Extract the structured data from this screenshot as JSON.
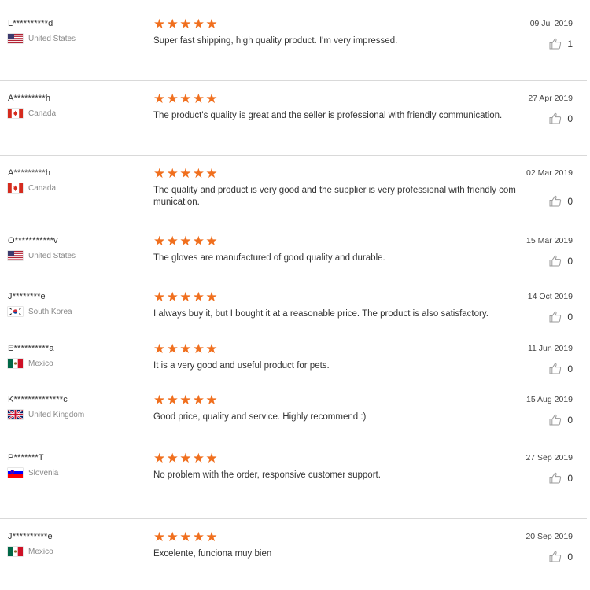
{
  "reviews": [
    {
      "name": "L**********d",
      "country": "United States",
      "flag": "us",
      "date": "09 Jul 2019",
      "comment": "Super fast shipping, high quality product. I'm very impressed.",
      "likes": "1"
    },
    {
      "name": "A*********h",
      "country": "Canada",
      "flag": "ca",
      "date": "27 Apr 2019",
      "comment": "The product's quality is great and the seller is professional with friendly communication.",
      "likes": "0"
    },
    {
      "name": "A*********h",
      "country": "Canada",
      "flag": "ca",
      "date": "02 Mar 2019",
      "comment": "The quality and product is very good and the supplier is very professional with friendly com munication.",
      "likes": "0"
    },
    {
      "name": "O***********v",
      "country": "United States",
      "flag": "us",
      "date": "15 Mar 2019",
      "comment": "The gloves are manufactured of good quality and durable.",
      "likes": "0"
    },
    {
      "name": "J********e",
      "country": "South Korea",
      "flag": "kr",
      "date": "14 Oct 2019",
      "comment": "I always buy it, but I bought it at a reasonable price. The product is also satisfactory.",
      "likes": "0"
    },
    {
      "name": "E**********a",
      "country": "Mexico",
      "flag": "mx",
      "date": "11 Jun 2019",
      "comment": "It is a very good and useful product for pets.",
      "likes": "0"
    },
    {
      "name": "K**************c",
      "country": "United Kingdom",
      "flag": "gb",
      "date": "15 Aug 2019",
      "comment": "Good price, quality and service. Highly recommend :)",
      "likes": "0"
    },
    {
      "name": "P*******T",
      "country": "Slovenia",
      "flag": "si",
      "date": "27 Sep 2019",
      "comment": "No problem with the order, responsive customer support.",
      "likes": "0"
    },
    {
      "name": "J**********e",
      "country": "Mexico",
      "flag": "mx",
      "date": "20 Sep 2019",
      "comment": "Excelente, funciona muy bien",
      "likes": "0"
    }
  ],
  "rating": {
    "stars": "★★★★★",
    "value": 5,
    "max": 5,
    "color": "#f06f1e"
  }
}
